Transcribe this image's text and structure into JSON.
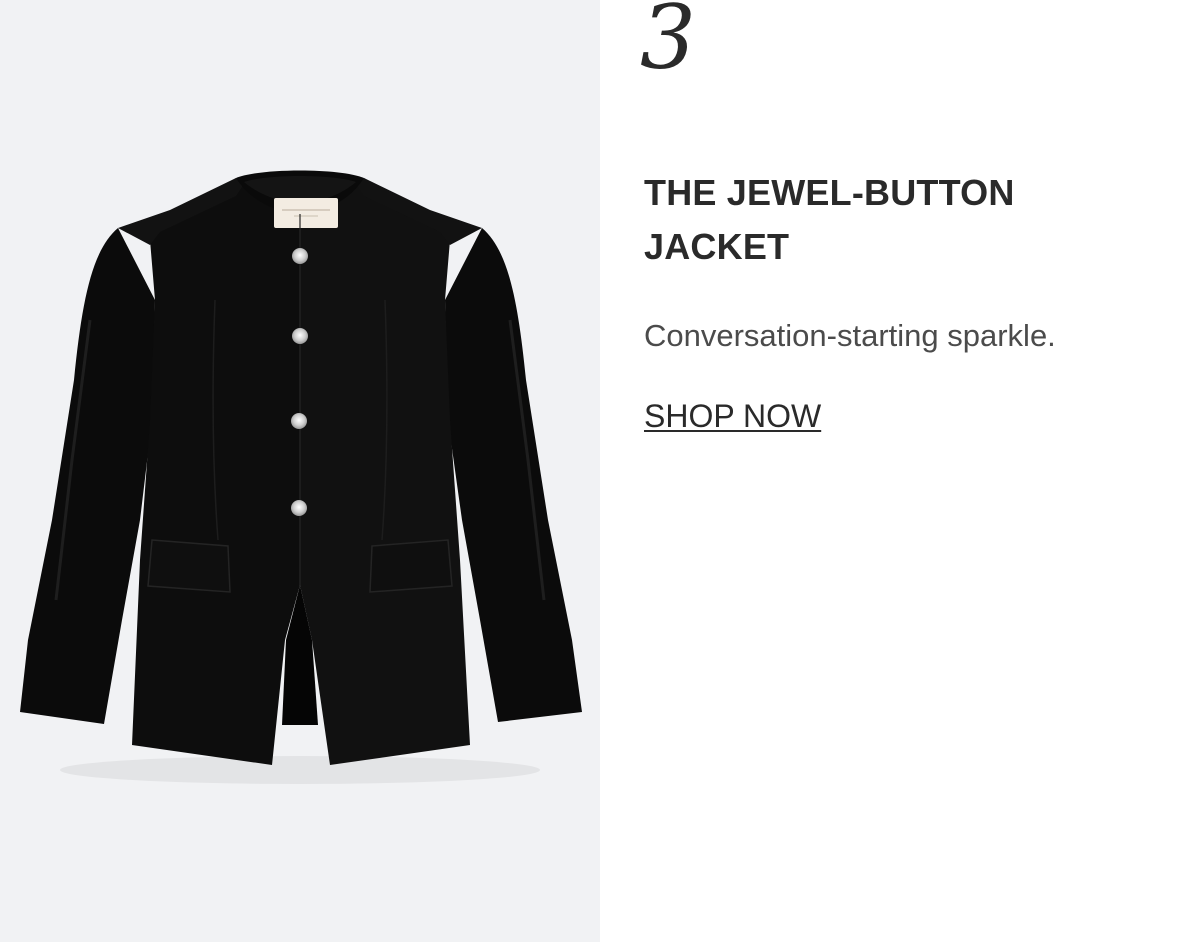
{
  "feature": {
    "number": "3",
    "title": "THE JEWEL-BUTTON JACKET",
    "subtitle": "Conversation-starting sparkle.",
    "cta_label": "SHOP NOW"
  },
  "product_image": {
    "label_text": "LAFAYETTE 148 NEW YORK",
    "colors": {
      "background": "#f1f2f4",
      "jacket": "#0d0d0d",
      "buttons": "#d8d8d8"
    }
  }
}
